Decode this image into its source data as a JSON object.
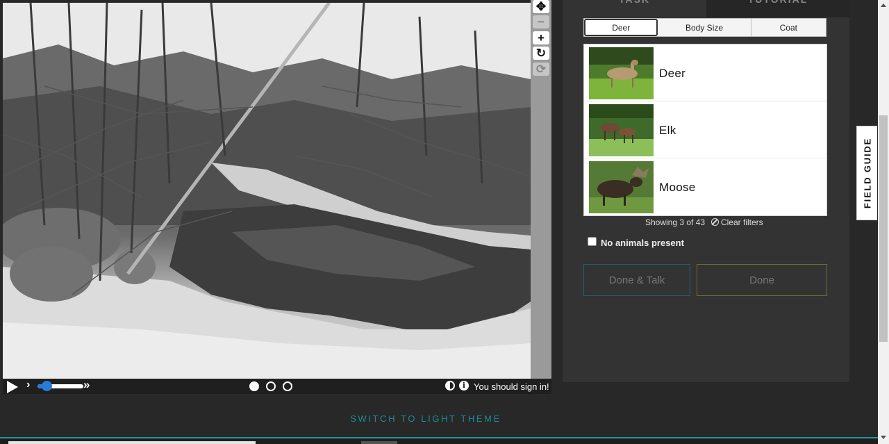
{
  "viewer_tools": {
    "move_icon": "move-icon",
    "zoom_out_icon": "zoom-out-icon",
    "zoom_in_icon": "zoom-in-icon",
    "rotate_icon": "rotate-icon",
    "reset_icon": "reset-icon"
  },
  "controls": {
    "signin_text": "You should sign in!",
    "frames": 3,
    "active_frame": 1
  },
  "panel": {
    "tabs": [
      "TASK",
      "TUTORIAL"
    ],
    "filters": [
      "Deer",
      "Body Size",
      "Coat"
    ],
    "choices": [
      {
        "label": "Deer"
      },
      {
        "label": "Elk"
      },
      {
        "label": "Moose"
      }
    ],
    "showing": "Showing 3 of 43",
    "clear_filters": "Clear filters",
    "no_animals": "No animals present",
    "done_talk": "Done & Talk",
    "done": "Done"
  },
  "field_guide": "FIELD GUIDE",
  "theme_switch": "SWITCH TO LIGHT THEME",
  "colors": {
    "background": "#282828",
    "panel": "#333333",
    "accent_teal": "#1e8a95",
    "slider_blue": "#2a7ad8"
  }
}
